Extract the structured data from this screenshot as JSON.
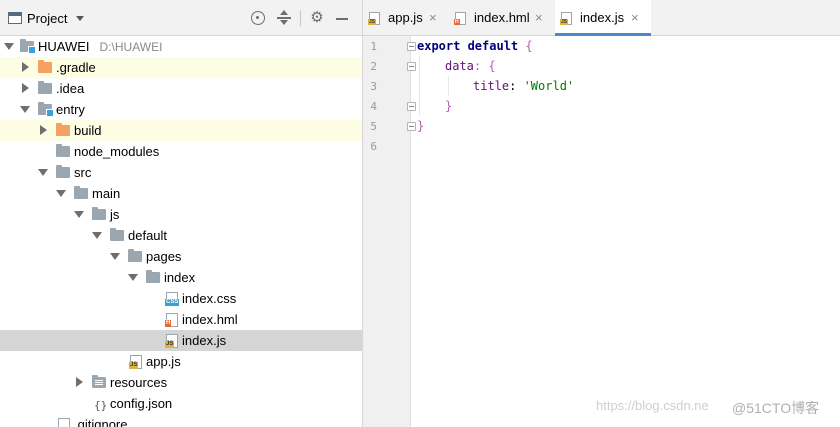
{
  "panel": {
    "title": "Project",
    "icons": [
      "project-icon",
      "dropdown-caret",
      "locate-target-icon",
      "collapse-all-icon",
      "gear-icon",
      "minimize-icon"
    ]
  },
  "tree": [
    {
      "label": "HUAWEI",
      "path": "D:\\HUAWEI",
      "icon": "module-folder",
      "arrow": "down"
    },
    {
      "label": ".gradle",
      "icon": "folder-orange",
      "arrow": "right",
      "highlight": true
    },
    {
      "label": ".idea",
      "icon": "folder",
      "arrow": "right"
    },
    {
      "label": "entry",
      "icon": "module-folder",
      "arrow": "down"
    },
    {
      "label": "build",
      "icon": "folder-orange",
      "arrow": "right",
      "highlight": true
    },
    {
      "label": "node_modules",
      "icon": "folder"
    },
    {
      "label": "src",
      "icon": "folder",
      "arrow": "down"
    },
    {
      "label": "main",
      "icon": "folder",
      "arrow": "down"
    },
    {
      "label": "js",
      "icon": "folder",
      "arrow": "down"
    },
    {
      "label": "default",
      "icon": "folder",
      "arrow": "down"
    },
    {
      "label": "pages",
      "icon": "folder",
      "arrow": "down"
    },
    {
      "label": "index",
      "icon": "folder",
      "arrow": "down"
    },
    {
      "label": "index.css",
      "icon": "css-file"
    },
    {
      "label": "index.hml",
      "icon": "html-file"
    },
    {
      "label": "index.js",
      "icon": "js-file",
      "selected": true
    },
    {
      "label": "app.js",
      "icon": "js-file"
    },
    {
      "label": "resources",
      "icon": "resources-folder",
      "arrow": "right"
    },
    {
      "label": "config.json",
      "icon": "json-file"
    },
    {
      "label": ".gitignore",
      "icon": "text-file"
    }
  ],
  "tabs": [
    {
      "label": "app.js",
      "icon": "js-file",
      "active": false
    },
    {
      "label": "index.hml",
      "icon": "html-file",
      "active": false
    },
    {
      "label": "index.js",
      "icon": "js-file",
      "active": true
    }
  ],
  "tab_close_glyph": "×",
  "editor": {
    "line_numbers": [
      "1",
      "2",
      "3",
      "4",
      "5",
      "6"
    ],
    "code": [
      {
        "kw": "export default",
        "punct": " {"
      },
      {
        "prop": "data",
        "punct": ": {"
      },
      {
        "prop": "title",
        "punct": ": ",
        "str": "'World'"
      },
      {
        "punct": "}"
      },
      {
        "punct": "}"
      },
      {}
    ]
  },
  "badges": {
    "css": "CSS",
    "html": "H",
    "js": "JS",
    "json": "{}"
  },
  "colors": {
    "accent": "#4a88c7",
    "selected_row": "#d5d5d5",
    "highlight_row": "#fdfde3",
    "keyword": "#000080",
    "property": "#660e7a",
    "string": "#008000"
  },
  "watermark": {
    "url": "https://blog.csdn.ne",
    "brand": "@51CTO博客"
  }
}
